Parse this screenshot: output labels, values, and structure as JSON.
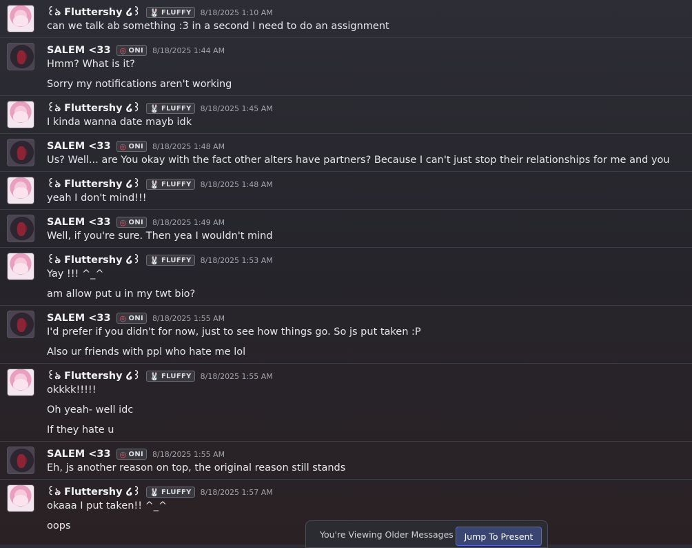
{
  "users": {
    "fluttershy": {
      "name": "꒰ঌ Fluttershy ໒꒱",
      "tag": "FLUFFY",
      "tag_icon": "🐰"
    },
    "salem": {
      "name": "SALEM <33",
      "tag": "ONI",
      "tag_icon": "◎"
    }
  },
  "groups": [
    {
      "user": "fluttershy",
      "time": "8/18/2025 1:10 AM",
      "lines": [
        "can we talk ab something :3 in a second I need to do an assignment"
      ]
    },
    {
      "user": "salem",
      "time": "8/18/2025 1:44 AM",
      "lines": [
        "Hmm? What is it?",
        "Sorry my notifications aren't working"
      ]
    },
    {
      "user": "fluttershy",
      "time": "8/18/2025 1:45 AM",
      "lines": [
        "I kinda wanna date mayb idk"
      ]
    },
    {
      "user": "salem",
      "time": "8/18/2025 1:48 AM",
      "lines": [
        "Us? Well... are You okay with the fact other alters have partners? Because I can't just stop their relationships for me and you"
      ]
    },
    {
      "user": "fluttershy",
      "time": "8/18/2025 1:48 AM",
      "lines": [
        "yeah I don't mind!!!"
      ]
    },
    {
      "user": "salem",
      "time": "8/18/2025 1:49 AM",
      "lines": [
        "Well, if you're sure. Then yea I wouldn't mind"
      ]
    },
    {
      "user": "fluttershy",
      "time": "8/18/2025 1:53 AM",
      "lines": [
        "Yay !!! ^_^",
        "am allow put u in my twt bio?"
      ]
    },
    {
      "user": "salem",
      "time": "8/18/2025 1:55 AM",
      "lines": [
        "I'd prefer if you didn't for now, just to see how things go. So js put taken :P",
        "Also ur friends with ppl who hate me lol"
      ]
    },
    {
      "user": "fluttershy",
      "time": "8/18/2025 1:55 AM",
      "lines": [
        "okkkk!!!!!",
        "Oh yeah- well idc",
        "If they hate u"
      ]
    },
    {
      "user": "salem",
      "time": "8/18/2025 1:55 AM",
      "lines": [
        "Eh, js another reason on top, the original reason still stands"
      ]
    },
    {
      "user": "fluttershy",
      "time": "8/18/2025 1:57 AM",
      "lines": [
        "okaaa I put taken!! ^_^",
        "oops"
      ]
    }
  ],
  "older_bar": {
    "text": "You're Viewing Older Messages",
    "button": "Jump To Present"
  }
}
